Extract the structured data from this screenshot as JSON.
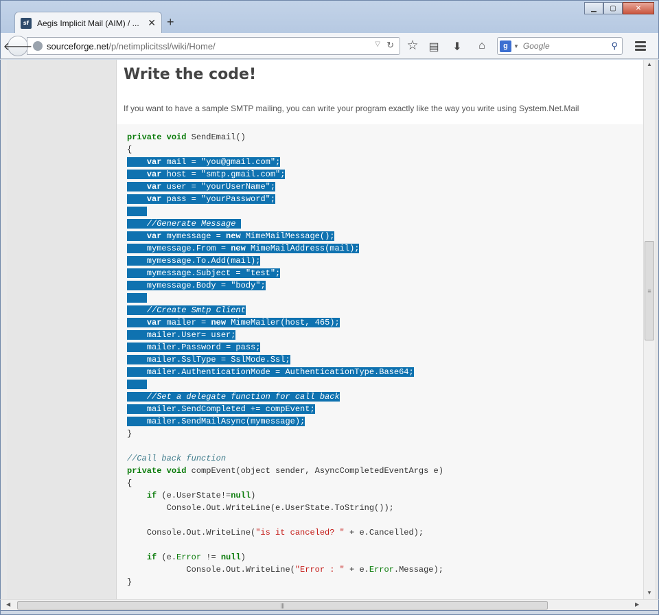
{
  "browser": {
    "tab_title": "Aegis Implicit Mail (AIM) / ...",
    "tab_icon_text": "sf",
    "url_host": "sourceforge.net",
    "url_path": "/p/netimplicitssl/wiki/Home/",
    "search_placeholder": "Google"
  },
  "page": {
    "heading": "Write the code!",
    "intro": "If you want to have a sample SMTP mailing, you can write your program exactly like the way you write using System.Net.Mail"
  },
  "code_lines": [
    "private void SendEmail()",
    "{",
    "    var mail = \"you@gmail.com\";",
    "    var host = \"smtp.gmail.com\";",
    "    var user = \"yourUserName\";",
    "    var pass = \"yourPassword\";",
    "",
    "    //Generate Message ",
    "    var mymessage = new MimeMailMessage();",
    "    mymessage.From = new MimeMailAddress(mail);",
    "    mymessage.To.Add(mail);",
    "    mymessage.Subject = \"test\";",
    "    mymessage.Body = \"body\";",
    "",
    "    //Create Smtp Client",
    "    var mailer = new MimeMailer(host, 465);",
    "    mailer.User= user;",
    "    mailer.Password = pass;",
    "    mailer.SslType = SslMode.Ssl;",
    "    mailer.AuthenticationMode = AuthenticationType.Base64;",
    "",
    "    //Set a delegate function for call back",
    "    mailer.SendCompleted += compEvent;",
    "    mailer.SendMailAsync(mymessage);",
    "}",
    "",
    "//Call back function",
    "private void compEvent(object sender, AsyncCompletedEventArgs e)",
    "{",
    "    if (e.UserState!=null)",
    "        Console.Out.WriteLine(e.UserState.ToString());",
    "",
    "    Console.Out.WriteLine(\"is it canceled? \" + e.Cancelled);",
    "",
    "    if (e.Error != null)",
    "            Console.Out.WriteLine(\"Error : \" + e.Error.Message);",
    "}"
  ],
  "selected_line_range": [
    2,
    23
  ],
  "colors": {
    "selection": "#0f72b0",
    "keyword": "#0a7b0a",
    "string": "#c41a16",
    "comment": "#3d7a8a"
  }
}
